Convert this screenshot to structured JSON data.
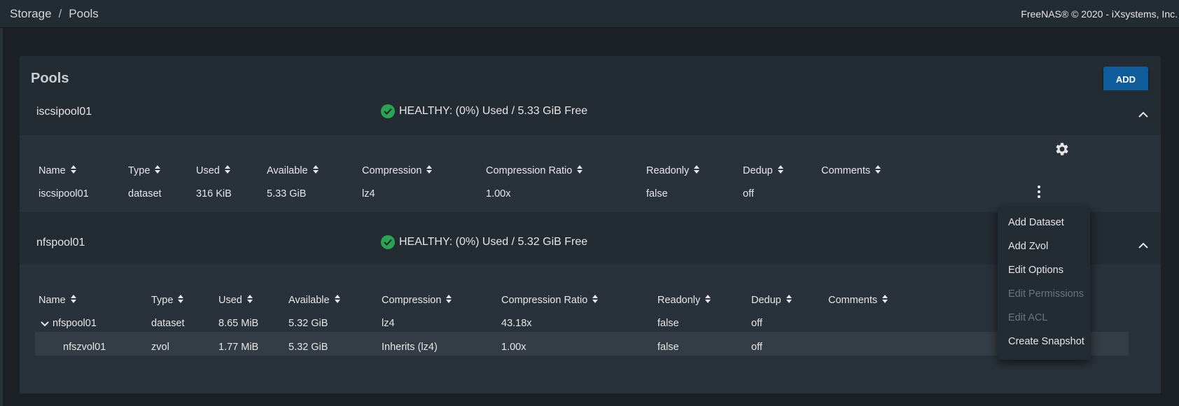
{
  "breadcrumb": {
    "parent": "Storage",
    "separator": "/",
    "current": "Pools"
  },
  "copyright": "FreeNAS® © 2020 - iXsystems, Inc.",
  "card": {
    "title": "Pools",
    "add_label": "ADD"
  },
  "columns_label": {
    "name": "Name",
    "type": "Type",
    "used": "Used",
    "available": "Available",
    "compression": "Compression",
    "compression_ratio": "Compression Ratio",
    "readonly": "Readonly",
    "dedup": "Dedup",
    "comments": "Comments"
  },
  "pools": [
    {
      "name": "iscsipool01",
      "status": "HEALTHY: (0%) Used / 5.33 GiB Free",
      "rows": [
        {
          "name": "iscsipool01",
          "type": "dataset",
          "used": "316 KiB",
          "available": "5.33 GiB",
          "compression": "lz4",
          "compression_ratio": "1.00x",
          "readonly": "false",
          "dedup": "off",
          "comments": ""
        }
      ]
    },
    {
      "name": "nfspool01",
      "status": "HEALTHY: (0%) Used / 5.32 GiB Free",
      "rows": [
        {
          "name": "nfspool01",
          "type": "dataset",
          "used": "8.65 MiB",
          "available": "5.32 GiB",
          "compression": "lz4",
          "compression_ratio": "43.18x",
          "readonly": "false",
          "dedup": "off",
          "comments": ""
        },
        {
          "name": "nfszvol01",
          "type": "zvol",
          "used": "1.77 MiB",
          "available": "5.32 GiB",
          "compression": "Inherits (lz4)",
          "compression_ratio": "1.00x",
          "readonly": "false",
          "dedup": "off",
          "comments": ""
        }
      ]
    }
  ],
  "dataset_menu": {
    "items": [
      {
        "label": "Add Dataset",
        "disabled": false
      },
      {
        "label": "Add Zvol",
        "disabled": false
      },
      {
        "label": "Edit Options",
        "disabled": false
      },
      {
        "label": "Edit Permissions",
        "disabled": true
      },
      {
        "label": "Edit ACL",
        "disabled": true
      },
      {
        "label": "Create Snapshot",
        "disabled": false
      }
    ]
  },
  "colors": {
    "accent": "#0f5d9b",
    "healthy": "#2aa353",
    "background": "#1b2127",
    "card": "#232b33"
  },
  "icons": [
    "check-circle-icon",
    "chevron-up-icon",
    "gear-icon",
    "sort-icon",
    "more-vert-icon",
    "chevron-down-icon"
  ]
}
